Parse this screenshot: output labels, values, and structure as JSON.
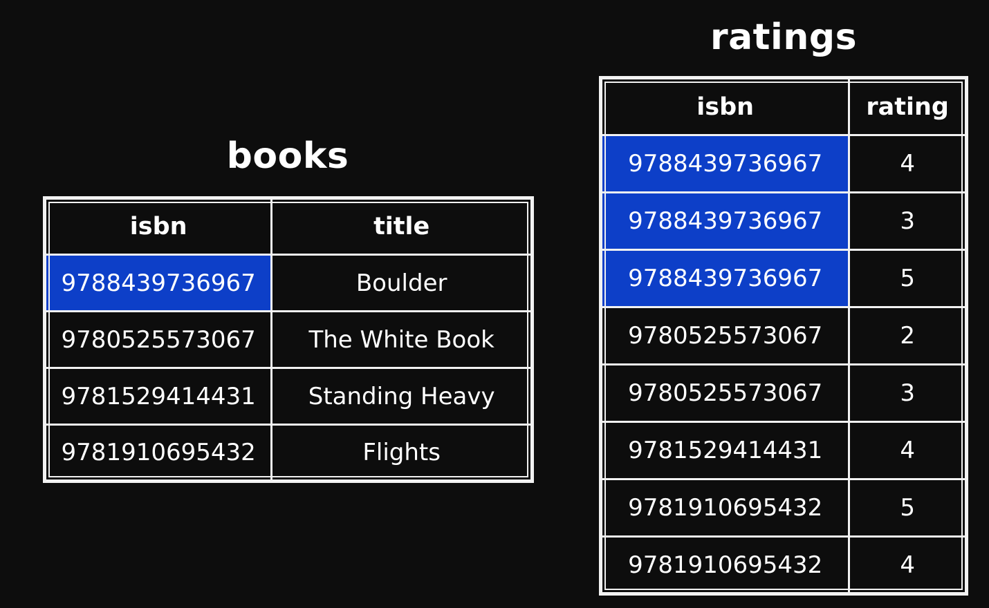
{
  "books": {
    "title": "books",
    "columns": [
      "isbn",
      "title"
    ],
    "rows": [
      {
        "isbn": "9788439736967",
        "title": "Boulder",
        "highlighted": true
      },
      {
        "isbn": "9780525573067",
        "title": "The White Book",
        "highlighted": false
      },
      {
        "isbn": "9781529414431",
        "title": "Standing Heavy",
        "highlighted": false
      },
      {
        "isbn": "9781910695432",
        "title": "Flights",
        "highlighted": false
      }
    ]
  },
  "ratings": {
    "title": "ratings",
    "columns": [
      "isbn",
      "rating"
    ],
    "rows": [
      {
        "isbn": "9788439736967",
        "rating": "4",
        "highlighted": true
      },
      {
        "isbn": "9788439736967",
        "rating": "3",
        "highlighted": true
      },
      {
        "isbn": "9788439736967",
        "rating": "5",
        "highlighted": true
      },
      {
        "isbn": "9780525573067",
        "rating": "2",
        "highlighted": false
      },
      {
        "isbn": "9780525573067",
        "rating": "3",
        "highlighted": false
      },
      {
        "isbn": "9781529414431",
        "rating": "4",
        "highlighted": false
      },
      {
        "isbn": "9781910695432",
        "rating": "5",
        "highlighted": false
      },
      {
        "isbn": "9781910695432",
        "rating": "4",
        "highlighted": false
      }
    ]
  },
  "colors": {
    "background": "#0d0d0d",
    "highlight": "#0d3fc8",
    "border": "#f2f2f2",
    "text": "#ffffff"
  }
}
